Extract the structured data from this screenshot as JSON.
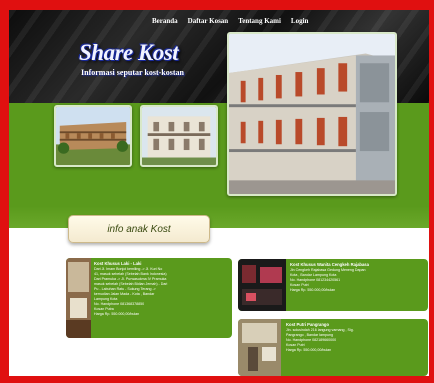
{
  "nav": {
    "items": [
      "Beranda",
      "Daftar Kosan",
      "Tentang Kami",
      "Login"
    ]
  },
  "logo": {
    "title": "Share Kost",
    "subtitle": "Informasi seputar kost-kostan"
  },
  "section": {
    "title": "info anak Kost"
  },
  "cards": [
    {
      "title": "Kost Khusus Laki - Laki",
      "lines": [
        "Dari Jl. Imam Bonjol kemiling -> Jl. Kuri No",
        "41, masuk sebelah (Sebelah Bank Indonesia)",
        "Dari Pramuka -> Jl. Purwasukma IV Pramuka",
        "masuk sebelah (Sebelah Bidian Jemah) - Dari",
        "Pu - Labuhan Ratu - Sukung Terang ->",
        "kemudian Jalan Mada - Kota , Bandar",
        "Lampung Kota",
        "No. Handphone 081368378850",
        "Kosan Putra",
        "Harga Rp. 550.000,00/bulan"
      ]
    },
    {
      "title": "Kost Khusus Wanita Cengkeh Rajabasa",
      "lines": [
        "Jln Cengkeh Rajabasa Gedung Meneng Dapan",
        "Kota , Bandar Lampung Kota",
        "No. Handphone 081234420561",
        "Kosan Putri",
        "Harga Rp. 550.000,00/bulan"
      ]
    },
    {
      "title": "Kost Putri Pangrango",
      "lines": [
        "Jln. solusindah 216 langung varnang , Sig.",
        "Pangrango , Bandar lampung",
        "No. Handphone 082189660000",
        "Kosan Putri",
        "Harga Rp. 550.000,00/bulan"
      ]
    }
  ],
  "colors": {
    "frame": "#e01010",
    "green": "#5a9a1c",
    "header": "#111111"
  }
}
